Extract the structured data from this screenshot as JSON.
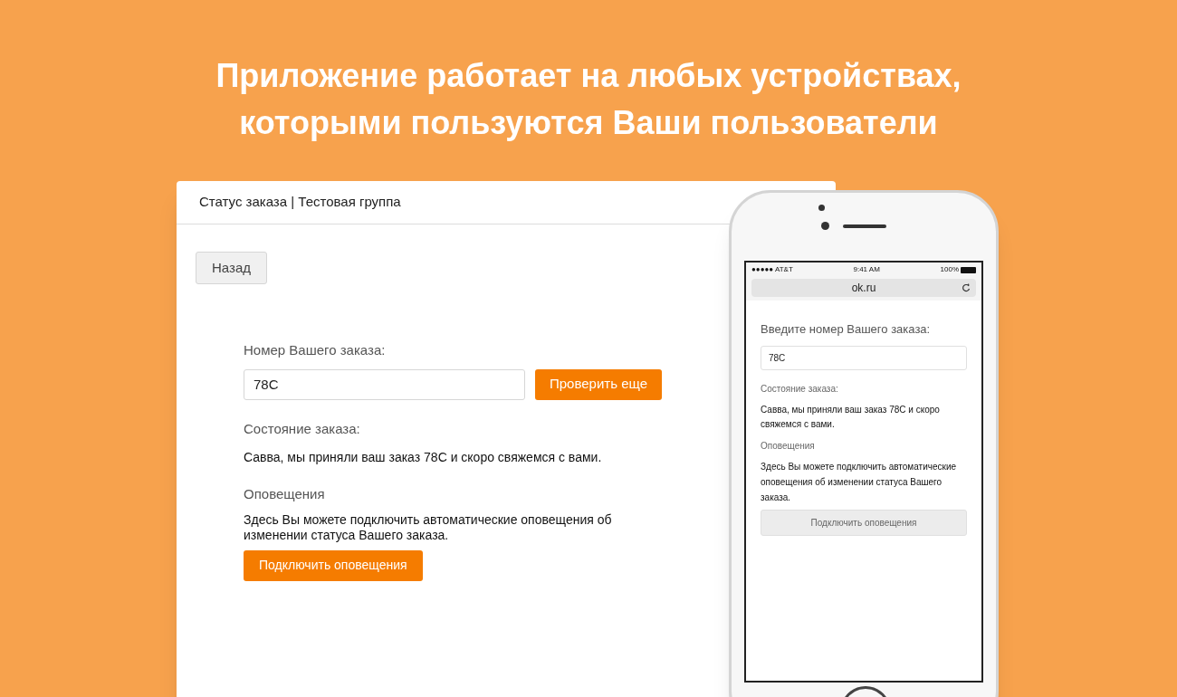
{
  "headline": [
    "Приложение работает на любых устройствах,",
    "которыми пользуются Ваши пользователи"
  ],
  "desktop": {
    "header": "Статус заказа | Тестовая группа",
    "back_button": "Назад",
    "order_label": "Номер Вашего заказа:",
    "order_value": "78C",
    "check_button": "Проверить еще",
    "status_label": "Состояние заказа:",
    "status_text": "Савва, мы приняли ваш заказ 78C и скоро свяжемся с вами.",
    "notify_label": "Оповещения",
    "notify_text": "Здесь Вы можете подключить автоматические оповещения об изменении статуса Вашего заказа.",
    "notify_button": "Подключить оповещения"
  },
  "phone": {
    "status_bar": {
      "carrier": "●●●●● AT&T",
      "time": "9:41 AM",
      "battery": "100%"
    },
    "address": "ok.ru",
    "order_label": "Введите номер Вашего заказа:",
    "order_value": "78C",
    "status_label": "Состояние заказа:",
    "status_text": "Савва, мы приняли ваш заказ 78C и скоро свяжемся с вами.",
    "notify_label": "Оповещения",
    "notify_text": "Здесь Вы можете подключить автоматические оповещения об изменении статуса Вашего заказа.",
    "notify_button": "Подключить оповещения"
  }
}
